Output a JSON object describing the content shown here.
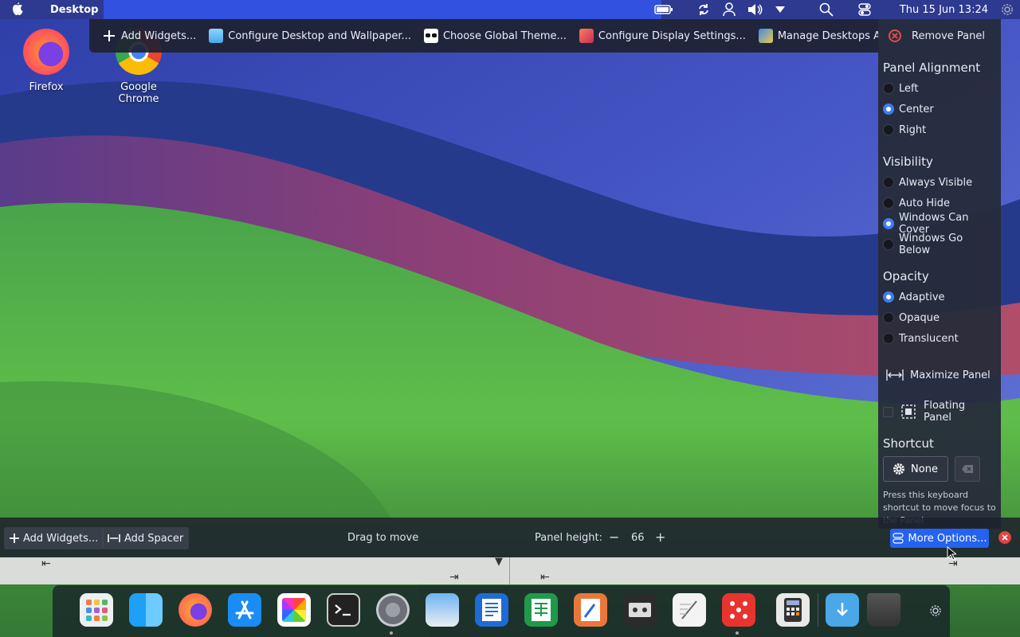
{
  "menubar": {
    "app_name": "Desktop",
    "clock": "Thu 15 Jun  13:24"
  },
  "desktop_toolbar": {
    "items": [
      {
        "label": "Add Widgets..."
      },
      {
        "label": "Configure Desktop and Wallpaper..."
      },
      {
        "label": "Choose Global Theme..."
      },
      {
        "label": "Configure Display Settings..."
      },
      {
        "label": "Manage Desktops And Panels"
      }
    ]
  },
  "desktop_icons": [
    {
      "label": "Firefox"
    },
    {
      "label": "Google Chrome"
    }
  ],
  "settings_panel": {
    "remove_panel": "Remove Panel",
    "alignment": {
      "heading": "Panel Alignment",
      "options": [
        "Left",
        "Center",
        "Right"
      ],
      "selected": "Center"
    },
    "visibility": {
      "heading": "Visibility",
      "options": [
        "Always Visible",
        "Auto Hide",
        "Windows Can Cover",
        "Windows Go Below"
      ],
      "selected": "Windows Can Cover"
    },
    "opacity": {
      "heading": "Opacity",
      "options": [
        "Adaptive",
        "Opaque",
        "Translucent"
      ],
      "selected": "Adaptive"
    },
    "maximize_panel": "Maximize Panel",
    "floating_panel": "Floating Panel",
    "shortcut": {
      "heading": "Shortcut",
      "value": "None",
      "hint": "Press this keyboard shortcut to move focus to the Panel"
    }
  },
  "editbar": {
    "add_widgets": "Add Widgets...",
    "add_spacer": "Add Spacer",
    "drag_to_move": "Drag to move",
    "panel_height_label": "Panel height:",
    "panel_height_value": "66",
    "more_options": "More Options..."
  },
  "colors": {
    "accent": "#2463f0",
    "menubar": "#2e3a8f",
    "close": "#e04343"
  }
}
